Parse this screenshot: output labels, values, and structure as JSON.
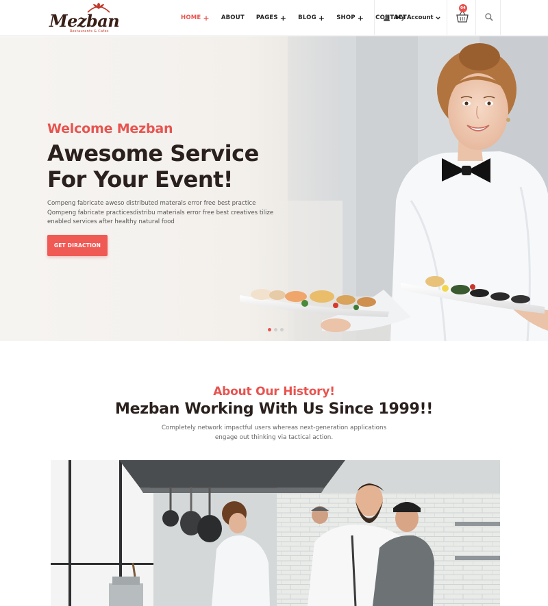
{
  "brand": {
    "name": "Mezban",
    "tagline": "Restaurants & Cafes",
    "accent_color": "#e8534f",
    "dark_color": "#2a201d"
  },
  "nav": {
    "items": [
      {
        "label": "HOME",
        "has_submenu": true,
        "active": true
      },
      {
        "label": "ABOUT",
        "has_submenu": false,
        "active": false
      },
      {
        "label": "PAGES",
        "has_submenu": true,
        "active": false
      },
      {
        "label": "BLOG",
        "has_submenu": true,
        "active": false
      },
      {
        "label": "SHOP",
        "has_submenu": true,
        "active": false
      },
      {
        "label": "CONTACT",
        "has_submenu": false,
        "active": false
      }
    ],
    "submenu_glyph": "+",
    "account_label": "My Account",
    "account_icon": "user-icon",
    "cart_icon": "basket-icon",
    "cart_count": "04",
    "search_icon": "search-icon"
  },
  "hero": {
    "welcome": "Welcome Mezban",
    "title_line1": "Awesome Service",
    "title_line2": "For Your Event!",
    "description": "Compeng fabricate aweso distributed materals error free best practice Qompeng fabricate practicesdistribu materials error free best creatives tilize enabled services after healthy natural food",
    "button_label": "GET DIRACTION",
    "slides": 3,
    "active_slide": 1
  },
  "about": {
    "subtitle": "About Our History!",
    "title": "Mezban Working With Us Since 1999!!",
    "description": "Completely network impactful users whereas next-generation applications engage out thinking via tactical action."
  }
}
